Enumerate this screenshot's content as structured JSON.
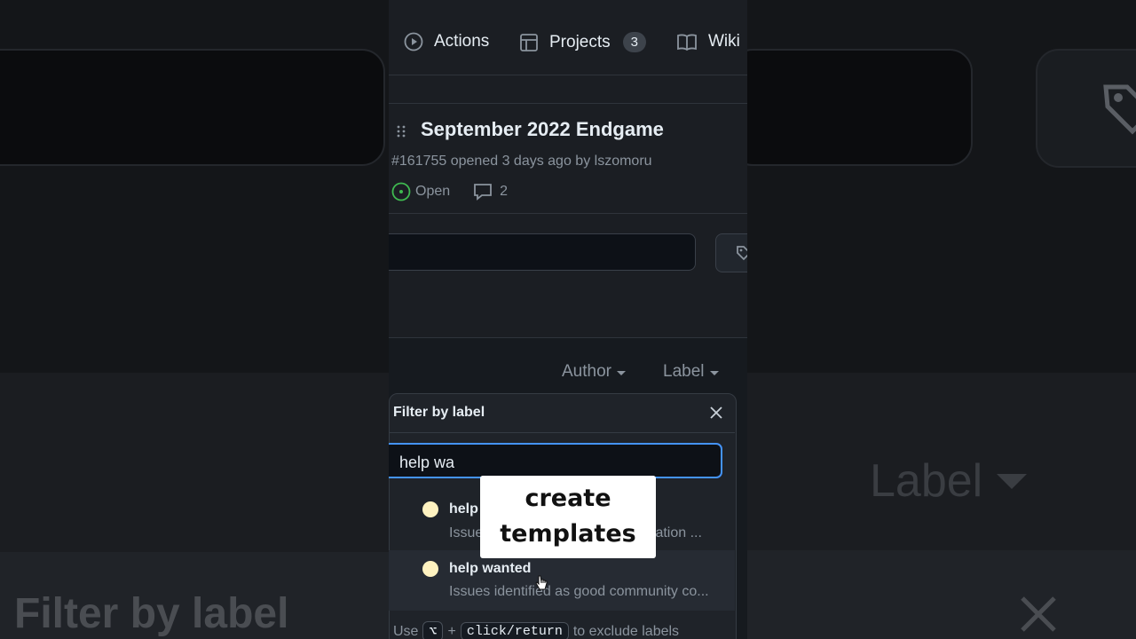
{
  "tabs": [
    {
      "label": "Actions",
      "icon": "play-circle-icon"
    },
    {
      "label": "Projects",
      "icon": "table-icon",
      "count": "3"
    },
    {
      "label": "Wiki",
      "icon": "book-icon"
    }
  ],
  "issue": {
    "title": "September 2022 Endgame",
    "meta": "#161755 opened 3 days ago by lszomoru",
    "status": "Open",
    "comments": "2"
  },
  "filters": {
    "author": "Author",
    "label": "Label"
  },
  "dropdown": {
    "title": "Filter by label",
    "query": "help wa",
    "items": [
      {
        "name": "help",
        "description": "Issue",
        "description_tail": "nslation ...",
        "color": "#fef2c0"
      },
      {
        "name": "help wanted",
        "description": "Issues identified as good community co...",
        "color": "#fef2c0"
      }
    ],
    "footer": {
      "prefix": "Use",
      "key1": "⌥",
      "plus": "+",
      "key2": "click/return",
      "suffix": "to exclude labels"
    }
  },
  "background": {
    "big_label": "Label",
    "big_filter": "Filter by label"
  },
  "caption": {
    "line1": "create",
    "line2": "templates"
  },
  "colors": {
    "accent_blue": "#4493f8",
    "open_green": "#3fb950",
    "label_yellow": "#fef2c0"
  }
}
